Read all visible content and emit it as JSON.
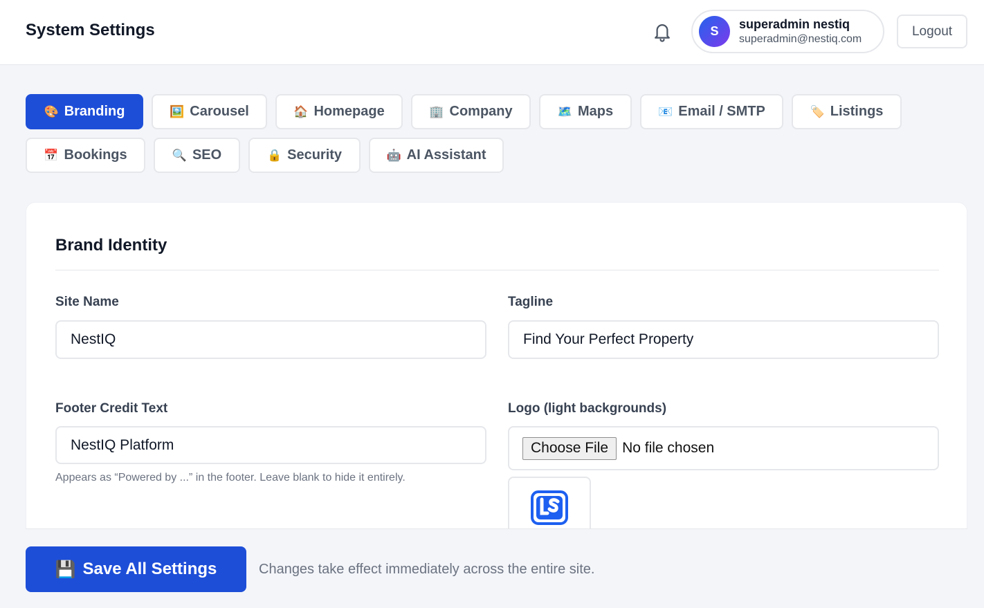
{
  "header": {
    "title": "System Settings",
    "user": {
      "initial": "S",
      "name": "superadmin nestiq",
      "email": "superadmin@nestiq.com"
    },
    "logout_label": "Logout"
  },
  "tabs": [
    {
      "icon": "🎨",
      "label": "Branding",
      "active": true
    },
    {
      "icon": "🖼️",
      "label": "Carousel"
    },
    {
      "icon": "🏠",
      "label": "Homepage"
    },
    {
      "icon": "🏢",
      "label": "Company"
    },
    {
      "icon": "🗺️",
      "label": "Maps"
    },
    {
      "icon": "📧",
      "label": "Email / SMTP"
    },
    {
      "icon": "🏷️",
      "label": "Listings"
    },
    {
      "icon": "📅",
      "label": "Bookings"
    },
    {
      "icon": "🔍",
      "label": "SEO"
    },
    {
      "icon": "🔒",
      "label": "Security"
    },
    {
      "icon": "🤖",
      "label": "AI Assistant"
    }
  ],
  "section": {
    "title": "Brand Identity",
    "site_name": {
      "label": "Site Name",
      "value": "NestIQ"
    },
    "tagline": {
      "label": "Tagline",
      "value": "Find Your Perfect Property"
    },
    "footer_credit": {
      "label": "Footer Credit Text",
      "value": "NestIQ Platform",
      "hint": "Appears as “Powered by ...” in the footer. Leave blank to hide it entirely."
    },
    "logo": {
      "label": "Logo (light backgrounds)",
      "button": "Choose File",
      "status": "No file chosen"
    }
  },
  "footer": {
    "save_icon": "💾",
    "save_label": "Save All Settings",
    "note": "Changes take effect immediately across the entire site."
  },
  "colors": {
    "primary": "#1d4ed8",
    "logo_blue": "#1d5ff0"
  }
}
